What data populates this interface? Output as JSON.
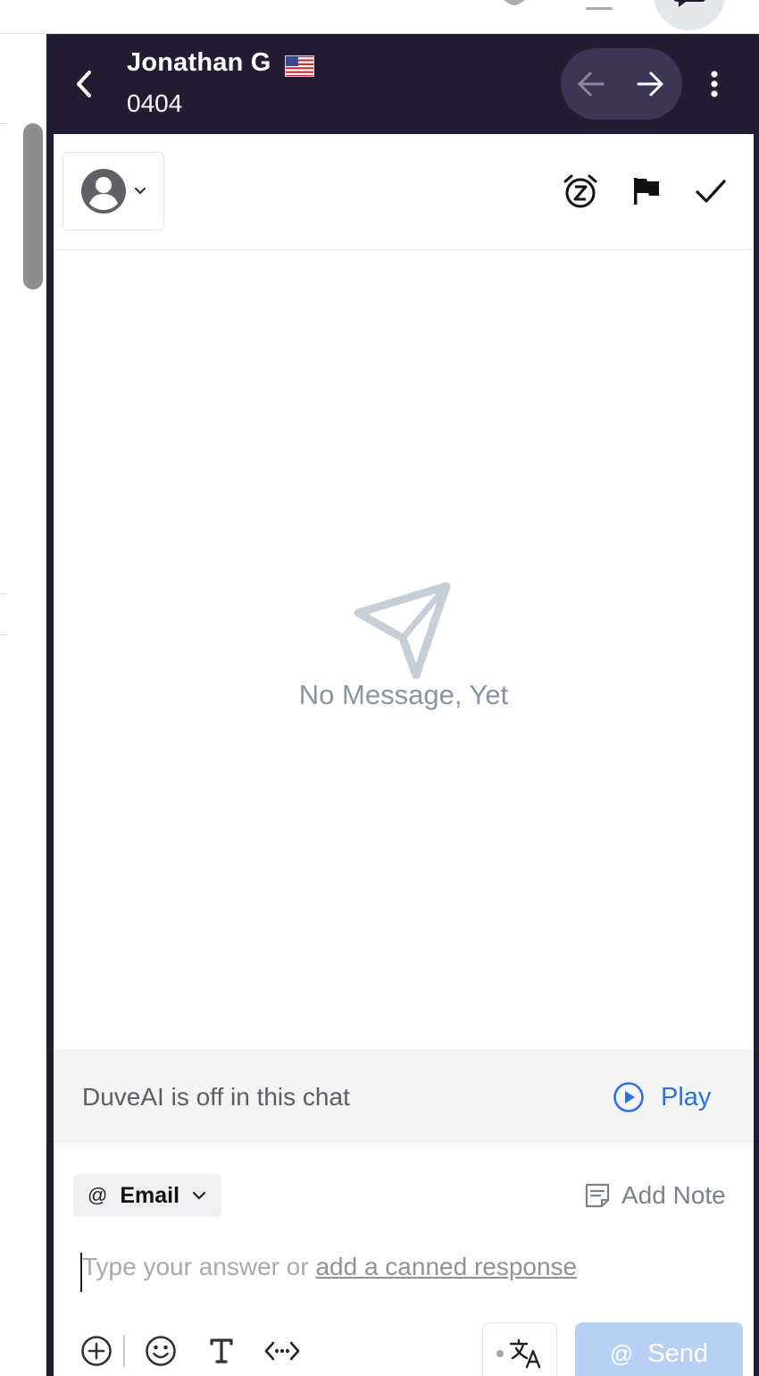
{
  "header": {
    "guest_name": "Jonathan G",
    "guest_sub": "0404"
  },
  "icons": {
    "back": "chevron-left-icon",
    "prev": "arrow-left-icon",
    "next": "arrow-right-icon",
    "more": "more-vertical-icon",
    "assign": "user-circle-icon",
    "snooze": "alarm-snooze-icon",
    "flag": "flag-icon",
    "resolve": "check-icon",
    "empty": "paper-plane-icon",
    "play": "play-circle-icon",
    "note": "note-icon",
    "attach": "plus-circle-icon",
    "emoji": "smile-icon",
    "format": "text-format-icon",
    "variable": "code-variable-icon",
    "translate": "translate-icon"
  },
  "empty_state": {
    "message": "No Message, Yet"
  },
  "ai_bar": {
    "status_text": "DuveAI is off in this chat",
    "play_label": "Play"
  },
  "composer": {
    "channel_symbol": "@",
    "channel_label": "Email",
    "add_note_label": "Add Note",
    "placeholder_prefix": "Type your answer or ",
    "placeholder_link": "add a canned response",
    "send_symbol": "@",
    "send_label": "Send"
  },
  "colors": {
    "header_bg": "#231c33",
    "accent_blue": "#2f6fde",
    "send_disabled": "#b8d0f4",
    "empty_gray": "#8a94a3"
  }
}
